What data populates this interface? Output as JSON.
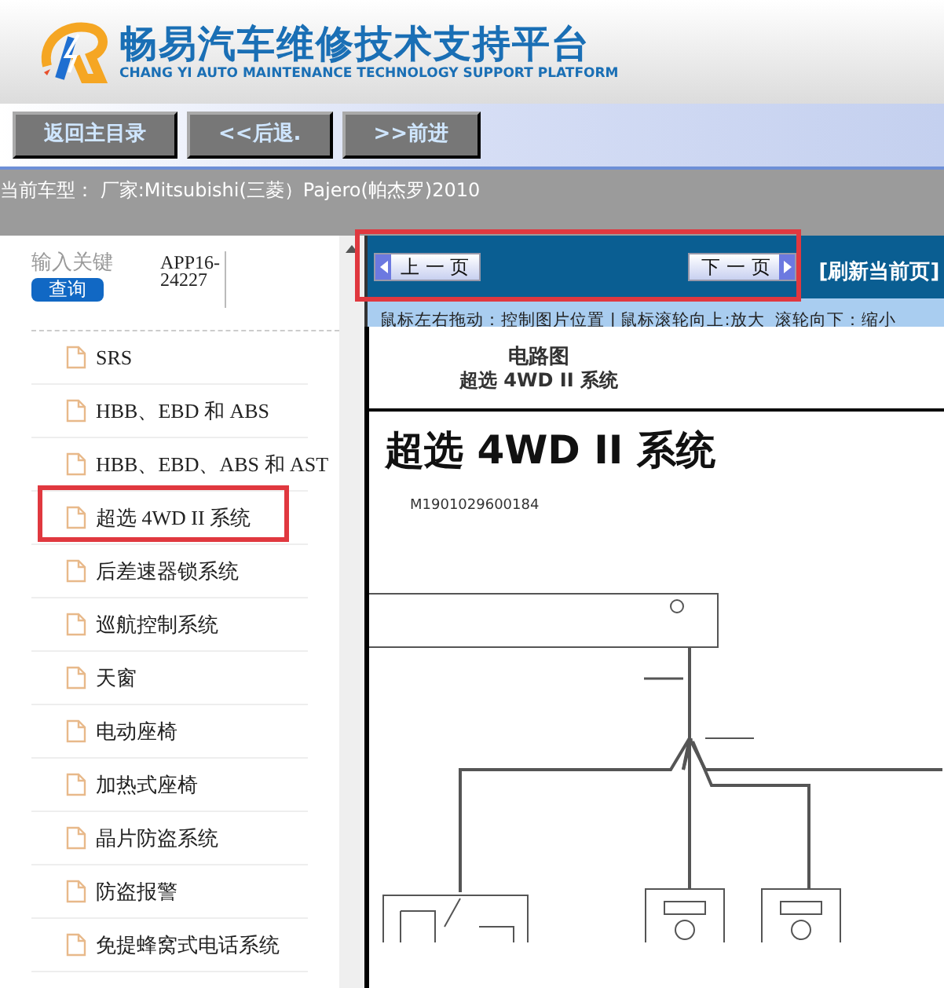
{
  "header": {
    "title": "畅易汽车维修技术支持平台",
    "subtitle": "CHANG YI AUTO MAINTENANCE TECHNOLOGY SUPPORT PLATFORM"
  },
  "nav_buttons": [
    "返回主目录",
    "<<后退.",
    ">>前进"
  ],
  "vehicle_bar": "当前车型： 厂家:Mitsubishi(三菱）Pajero(帕杰罗)2010",
  "search": {
    "label": "输入关键",
    "value": "APP16-24227",
    "button": "查询"
  },
  "tree": [
    {
      "label": "SRS",
      "highlighted": false
    },
    {
      "label": "HBB、EBD 和 ABS",
      "highlighted": false
    },
    {
      "label": "HBB、EBD、ABS 和 AST",
      "highlighted": false
    },
    {
      "label": "超选 4WD II 系统",
      "highlighted": true
    },
    {
      "label": "后差速器锁系统",
      "highlighted": false
    },
    {
      "label": "巡航控制系统",
      "highlighted": false
    },
    {
      "label": "天窗",
      "highlighted": false
    },
    {
      "label": "电动座椅",
      "highlighted": false
    },
    {
      "label": "加热式座椅",
      "highlighted": false
    },
    {
      "label": "晶片防盗系统",
      "highlighted": false
    },
    {
      "label": "防盗报警",
      "highlighted": false
    },
    {
      "label": "免提蜂窝式电话系统",
      "highlighted": false
    }
  ],
  "viewer": {
    "prev": "上 一 页",
    "next": "下 一 页",
    "pager_highlighted": true,
    "refresh": "[刷新当前页]",
    "hint": "鼠标左右拖动：控制图片位置 | 鼠标滚轮向上:放大  滚轮向下：缩小",
    "doc_heading": "电路图",
    "doc_subheading": "超选 4WD II 系统",
    "doc_title": "超选 4WD II 系统",
    "doc_code": "M1901029600184"
  }
}
